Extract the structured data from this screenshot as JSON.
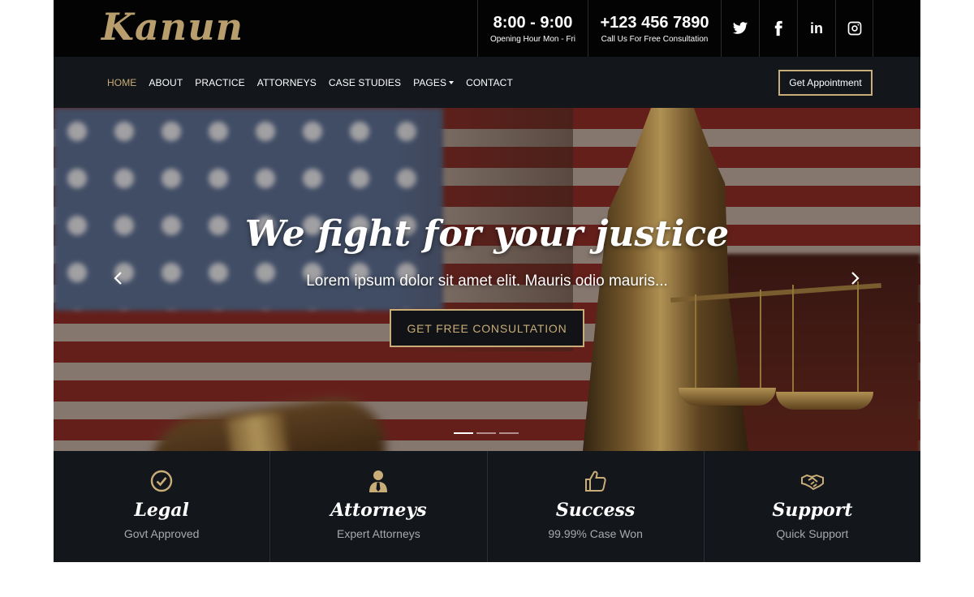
{
  "brand": {
    "logo_text": "Kanun",
    "accent_color": "#c9ad78"
  },
  "topbar": {
    "hours": {
      "value": "8:00 - 9:00",
      "caption": "Opening Hour Mon - Fri"
    },
    "phone": {
      "value": "+123 456 7890",
      "caption": "Call Us For Free Consultation"
    },
    "social": [
      {
        "icon": "twitter-icon"
      },
      {
        "icon": "facebook-icon"
      },
      {
        "icon": "linkedin-icon",
        "label": "in"
      },
      {
        "icon": "instagram-icon"
      }
    ]
  },
  "nav": {
    "items": [
      {
        "label": "HOME",
        "active": true
      },
      {
        "label": "ABOUT"
      },
      {
        "label": "PRACTICE"
      },
      {
        "label": "ATTORNEYS"
      },
      {
        "label": "CASE STUDIES"
      },
      {
        "label": "PAGES",
        "dropdown": true
      },
      {
        "label": "CONTACT"
      }
    ],
    "appointment_label": "Get Appointment"
  },
  "hero": {
    "title": "We fight for your justice",
    "subtitle": "Lorem ipsum dolor sit amet elit. Mauris odio mauris...",
    "cta_label": "GET FREE CONSULTATION",
    "slide_count": 3,
    "active_slide": 1
  },
  "features": [
    {
      "icon": "check-circle-icon",
      "title": "Legal",
      "subtitle": "Govt Approved"
    },
    {
      "icon": "user-tie-icon",
      "title": "Attorneys",
      "subtitle": "Expert Attorneys"
    },
    {
      "icon": "thumbs-up-icon",
      "title": "Success",
      "subtitle": "99.99% Case Won"
    },
    {
      "icon": "handshake-icon",
      "title": "Support",
      "subtitle": "Quick Support"
    }
  ]
}
